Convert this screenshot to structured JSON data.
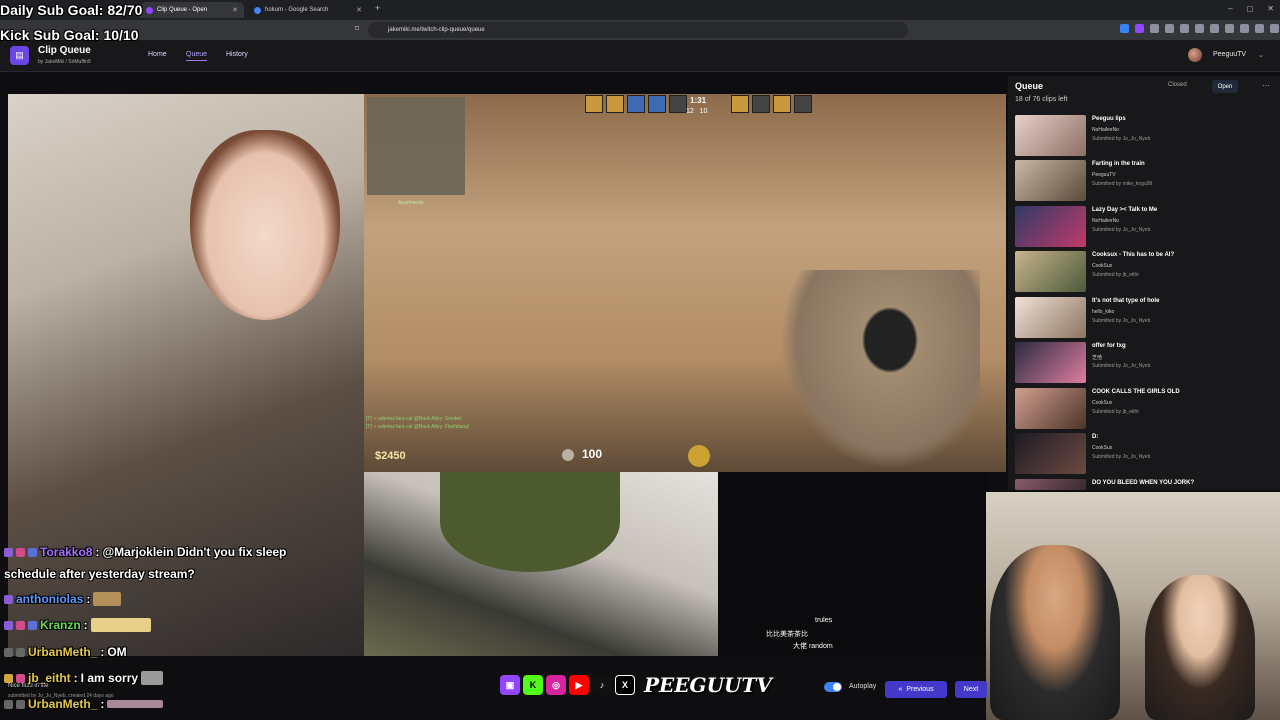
{
  "browser": {
    "tabs": [
      {
        "label": "Clip Queue - Open"
      },
      {
        "label": "hokum - Google Search"
      }
    ],
    "url": "jakemiki.me/twitch-clip-queue/queue",
    "window_controls": [
      "–",
      "◻",
      "✕"
    ]
  },
  "overlays": {
    "daily_goal": "Daily Sub Goal: 82/70",
    "kick_goal": "Kick Sub Goal: 10/10"
  },
  "app": {
    "title": "Clip Queue",
    "subtitle": "by JakeMiki / SirMuffin9",
    "nav": [
      "Home",
      "Queue",
      "History"
    ],
    "user": "PeeguuTV"
  },
  "game_hud": {
    "minimap_label": "Apartments",
    "round_time": "1:31",
    "score_ct": "12",
    "score_t": "10",
    "money": "$2450",
    "health": "100",
    "killfeed": [
      "[T] » calentul fara cal @Back Alley: Smoke!",
      "[T] » calentul fara cal @Back Alley: Flashbang!"
    ]
  },
  "chat": [
    {
      "user": "Torakko8",
      "sep": ":",
      "text": "@Marjoklein Didn't you fix sleep",
      "color": "#a970ff"
    },
    {
      "user": "",
      "sep": "",
      "text": "schedule after yesterday stream?",
      "color": "#ffffff"
    },
    {
      "user": "anthoniolas",
      "sep": ":",
      "text": "",
      "color": "#5b9bff"
    },
    {
      "user": "Kranzn",
      "sep": ":",
      "text": "",
      "color": "#6fda5a"
    },
    {
      "user": "UrbanMeth_",
      "sep": ":",
      "text": "OM",
      "color": "#e4c94a"
    },
    {
      "user": "jb_eitht",
      "sep": ":",
      "text": "I am sorry",
      "color": "#e4c94a"
    },
    {
      "user": "UrbanMeth_",
      "sep": ":",
      "text": "",
      "color": "#e4c94a"
    }
  ],
  "clip_meta": {
    "title": "Nice fluid in life",
    "submitted": "submitted by Jo_Jo_Nyeb, created 24 days ago"
  },
  "mini_chat": [
    {
      "text": "trules"
    },
    {
      "text": "比比美茶茶比"
    },
    {
      "text": "大佬 random"
    }
  ],
  "socials": [
    "Twitch",
    "Kick",
    "Instagram",
    "YouTube",
    "TikTok",
    "X"
  ],
  "brand": "PEEGUUTV",
  "controls": {
    "autoplay_label": "Autoplay",
    "autoplay_on": true,
    "previous": "Previous",
    "next": "Next"
  },
  "queue": {
    "title": "Queue",
    "count": "18 of 76 clips left",
    "closed": "Closed",
    "open": "Open",
    "items": [
      {
        "title": "Peeguu lips",
        "channel": "NoHaileeNo",
        "submitter": "Submitted by Jo_Jo_Nyeb",
        "thumb": "#c9a7a0"
      },
      {
        "title": "Farting in the train",
        "channel": "PeeguuTV",
        "submitter": "Submitted by mike_kogu99",
        "thumb": "#b8a189"
      },
      {
        "title": "Lazy Day >< Talk to Me",
        "channel": "NoHaileeNo",
        "submitter": "Submitted by Jo_Jo_Nyeb",
        "thumb": "#3d4a7a"
      },
      {
        "title": "Cooksux - This has to be AI?",
        "channel": "CookSux",
        "submitter": "Submitted by jb_eitht",
        "thumb": "#9a8a6a"
      },
      {
        "title": "It's not that type of hole",
        "channel": "hello_kiko",
        "submitter": "Submitted by Jo_Jo_Nyeb",
        "thumb": "#d9c6b4"
      },
      {
        "title": "offer for txg",
        "channel": "芝他",
        "submitter": "Submitted by Jo_Jo_Nyeb",
        "thumb": "#c47b8f"
      },
      {
        "title": "COOK CALLS THE GIRLS OLD",
        "channel": "CookSux",
        "submitter": "Submitted by jb_eitht",
        "thumb": "#8b6a5a"
      },
      {
        "title": "D:",
        "channel": "CookSux",
        "submitter": "Submitted by Jo_Jo_Nyeb",
        "thumb": "#3a2e2a"
      },
      {
        "title": "DO YOU BLEED WHEN YOU JORK?",
        "channel": "",
        "submitter": "",
        "thumb": "#6a4a5a"
      }
    ]
  }
}
